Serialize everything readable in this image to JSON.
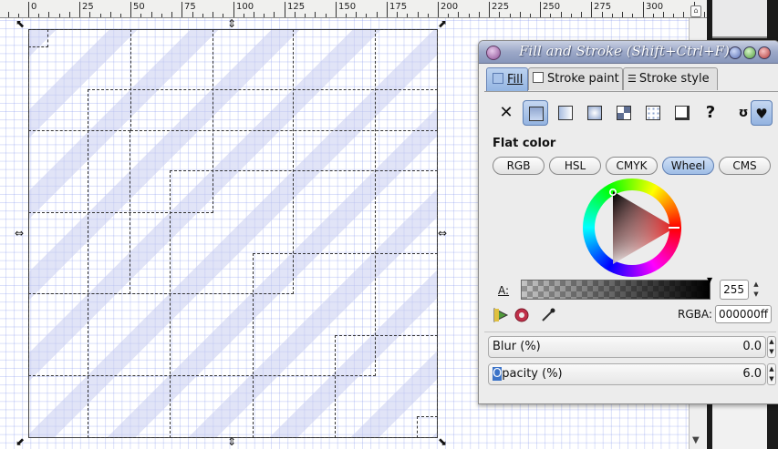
{
  "ruler": {
    "labels": [
      "0",
      "25",
      "50",
      "75",
      "100",
      "125",
      "150",
      "175",
      "200",
      "225",
      "250",
      "275",
      "300"
    ]
  },
  "dialog": {
    "title": "Fill and Stroke (Shift+Ctrl+F)",
    "tabs": {
      "fill": "Fill",
      "stroke_paint": "Stroke paint",
      "stroke_style": "Stroke style"
    },
    "paint_types": {
      "none": "✕",
      "unknown": "?"
    },
    "flat_color_label": "Flat color",
    "color_modes": [
      "RGB",
      "HSL",
      "CMYK",
      "Wheel",
      "CMS"
    ],
    "active_mode": "Wheel",
    "alpha": {
      "label": "A:",
      "value": "255"
    },
    "rgba": {
      "label": "RGBA:",
      "value": "000000ff"
    },
    "blur": {
      "label": "Blur (%)",
      "value": "0.0"
    },
    "opacity": {
      "label_highlight": "O",
      "label_rest": "pacity (%)",
      "value": "6.0"
    }
  },
  "colors": {
    "accent": "#92b4e2",
    "titlebar": "#8796ba",
    "current_color": "#000000"
  }
}
